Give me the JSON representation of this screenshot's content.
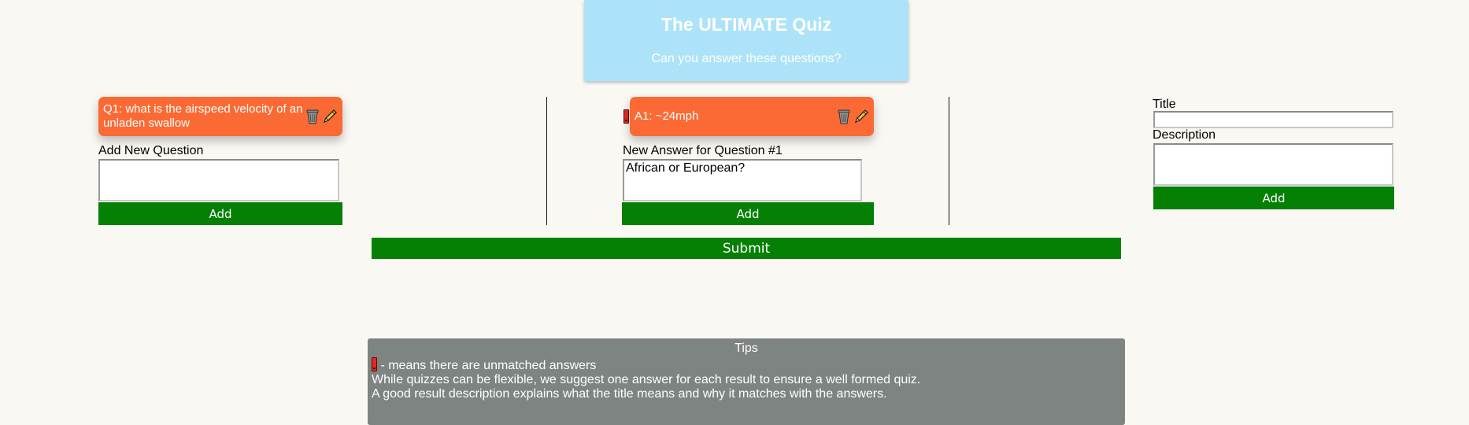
{
  "header": {
    "title": "The ULTIMATE Quiz",
    "subtitle": "Can you answer these questions?"
  },
  "questions": {
    "cards": [
      {
        "label": "Q1: what is the airspeed velocity of an unladen swallow"
      }
    ],
    "add_label": "Add New Question",
    "input_value": "",
    "add_button": "Add"
  },
  "answers": {
    "cards": [
      {
        "label": "A1: ~24mph",
        "unmatched": true
      }
    ],
    "add_label": "New Answer for Question #1",
    "input_value": "African or European?",
    "add_button": "Add"
  },
  "results": {
    "title_label": "Title",
    "title_value": "",
    "description_label": "Description",
    "description_value": "",
    "add_button": "Add"
  },
  "submit_button": "Submit",
  "tips": {
    "title": "Tips",
    "lines": [
      " - means there are unmatched answers",
      "While quizzes can be flexible, we suggest one answer for each result to ensure a well formed quiz.",
      "A good result description explains what the title means and why it matches with the answers."
    ]
  },
  "colors": {
    "background": "#faf8f3",
    "header": "#ade3f8",
    "card": "#fb6a34",
    "button": "#058005",
    "tips": "#7e8482",
    "warning": "#e42a20"
  },
  "icons": [
    "trash-icon",
    "pencil-icon",
    "exclamation-icon"
  ]
}
